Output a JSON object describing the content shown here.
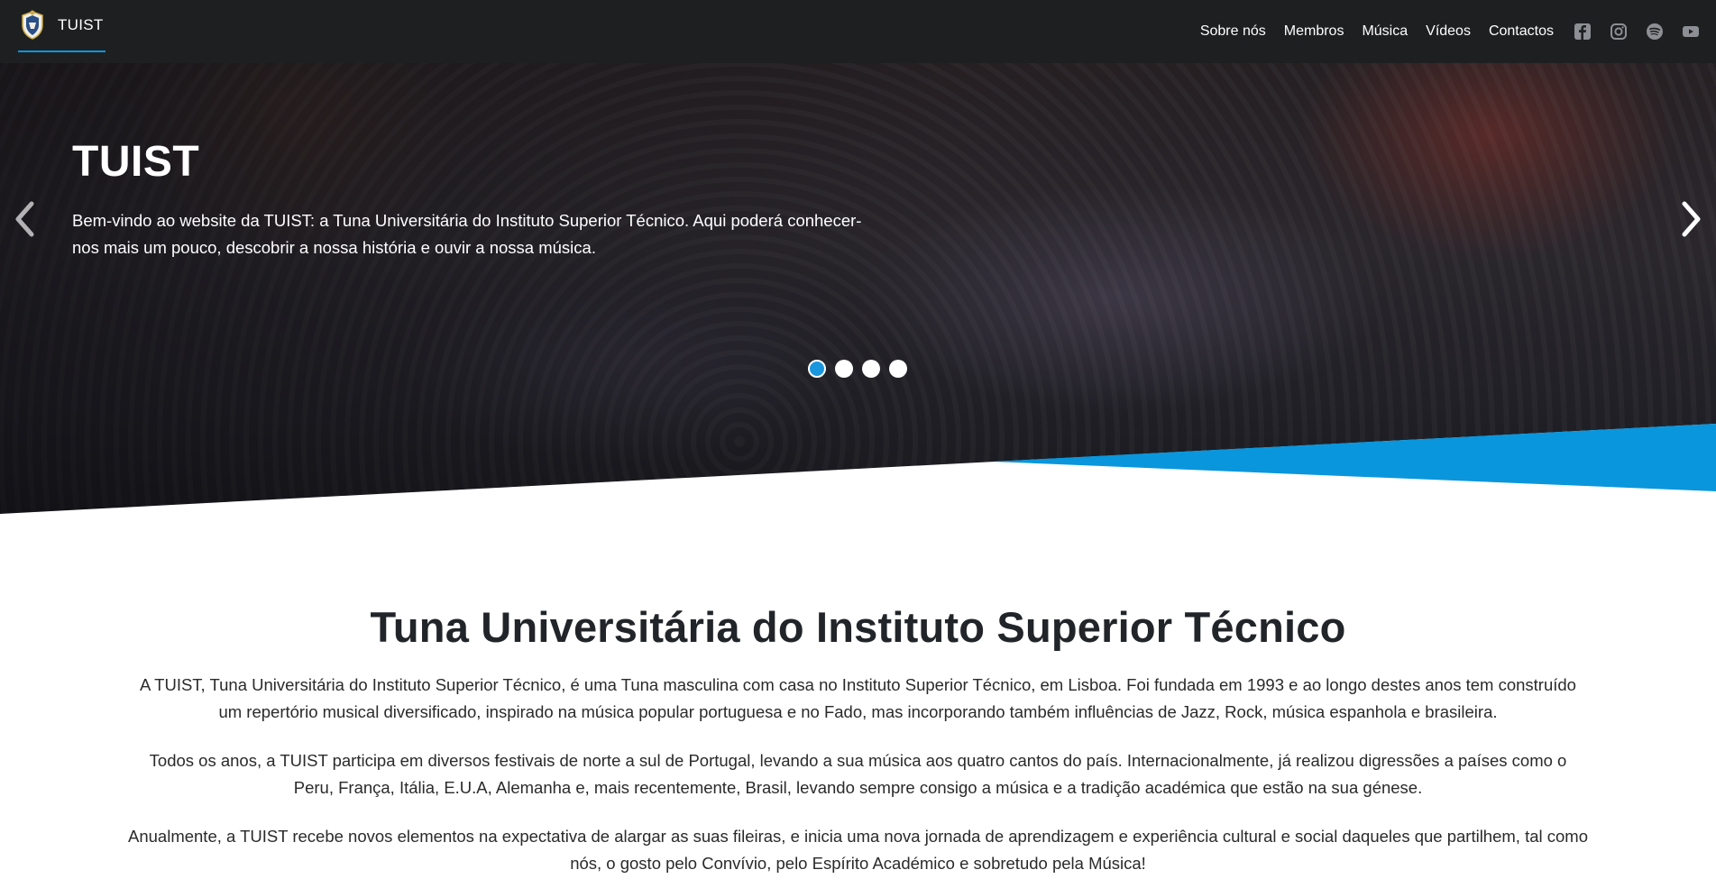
{
  "navbar": {
    "brand_name": "TUIST",
    "links": [
      "Sobre nós",
      "Membros",
      "Música",
      "Vídeos",
      "Contactos"
    ],
    "social_icons": [
      "facebook-icon",
      "instagram-icon",
      "spotify-icon",
      "youtube-icon"
    ],
    "background": "#1e1f21",
    "accent": "#0a96dc"
  },
  "hero": {
    "title": "TUIST",
    "text": "Bem-vindo ao website da TUIST: a Tuna Universitária do Instituto Superior Técnico. Aqui poderá conhecer-nos mais um pouco, descobrir a nossa história e ouvir a nossa música.",
    "slides_total": 4,
    "active_slide": 1,
    "prev_icon": "chevron-left-icon",
    "next_icon": "chevron-right-icon",
    "wedge_color": "#0a96dc"
  },
  "about": {
    "title": "Tuna Universitária do Instituto Superior Técnico",
    "paragraphs": [
      "A TUIST, Tuna Universitária do Instituto Superior Técnico, é uma Tuna masculina com casa no Instituto Superior Técnico, em Lisboa. Foi fundada em 1993 e ao longo destes anos tem construído um repertório musical diversificado, inspirado na música popular portuguesa e no Fado, mas incorporando também influências de Jazz, Rock, música espanhola e brasileira.",
      "Todos os anos, a TUIST participa em diversos festivais de norte a sul de Portugal, levando a sua música aos quatro cantos do país. Internacionalmente, já realizou digressões a países como o Peru, França, Itália, E.U.A, Alemanha e, mais recentemente, Brasil, levando sempre consigo a música e a tradição académica que estão na sua génese.",
      "Anualmente, a TUIST recebe novos elementos na expectativa de alargar as suas fileiras, e inicia uma nova jornada de aprendizagem e experiência cultural e social daqueles que partilhem, tal como nós, o gosto pelo Convívio, pelo Espírito Académico e sobretudo pela Música!"
    ]
  }
}
